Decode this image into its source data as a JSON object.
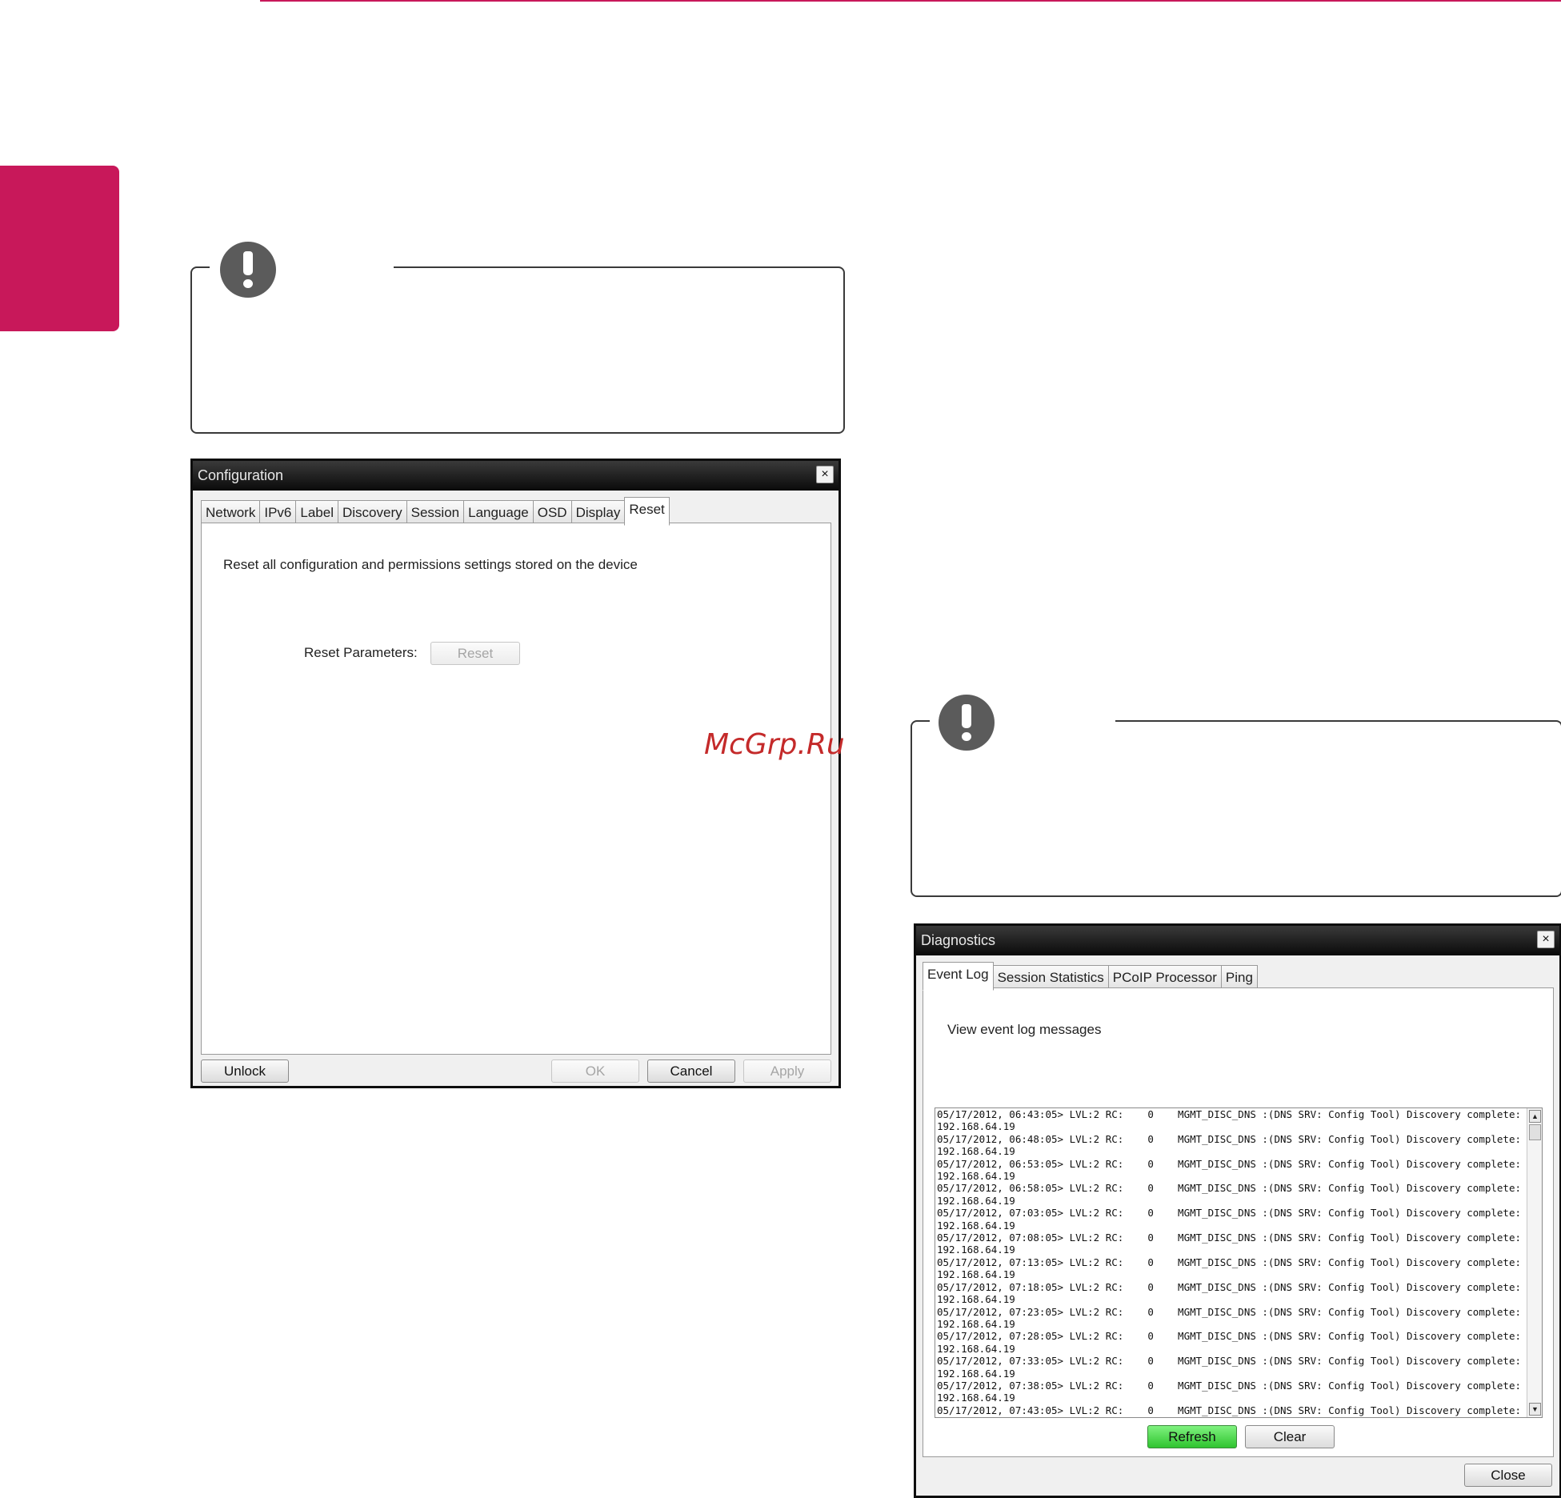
{
  "watermark": "McGrp.Ru",
  "configuration": {
    "title": "Configuration",
    "close": "×",
    "tabs": [
      "Network",
      "IPv6",
      "Label",
      "Discovery",
      "Session",
      "Language",
      "OSD",
      "Display",
      "Reset"
    ],
    "active_tab": "Reset",
    "description": "Reset all configuration and permissions settings stored on the device",
    "reset_label": "Reset Parameters:",
    "reset_button": "Reset",
    "unlock": "Unlock",
    "ok": "OK",
    "cancel": "Cancel",
    "apply": "Apply"
  },
  "diagnostics": {
    "title": "Diagnostics",
    "close": "×",
    "tabs": [
      "Event Log",
      "Session Statistics",
      "PCoIP Processor",
      "Ping"
    ],
    "active_tab": "Event Log",
    "description": "View event log messages",
    "log": [
      {
        "ts": "05/17/2012, 06:43:05>",
        "msg": "LVL:2 RC:    0    MGMT_DISC_DNS :(DNS SRV: Config Tool) Discovery complete:",
        "ip": "192.168.64.19"
      },
      {
        "ts": "05/17/2012, 06:48:05>",
        "msg": "LVL:2 RC:    0    MGMT_DISC_DNS :(DNS SRV: Config Tool) Discovery complete:",
        "ip": "192.168.64.19"
      },
      {
        "ts": "05/17/2012, 06:53:05>",
        "msg": "LVL:2 RC:    0    MGMT_DISC_DNS :(DNS SRV: Config Tool) Discovery complete:",
        "ip": "192.168.64.19"
      },
      {
        "ts": "05/17/2012, 06:58:05>",
        "msg": "LVL:2 RC:    0    MGMT_DISC_DNS :(DNS SRV: Config Tool) Discovery complete:",
        "ip": "192.168.64.19"
      },
      {
        "ts": "05/17/2012, 07:03:05>",
        "msg": "LVL:2 RC:    0    MGMT_DISC_DNS :(DNS SRV: Config Tool) Discovery complete:",
        "ip": "192.168.64.19"
      },
      {
        "ts": "05/17/2012, 07:08:05>",
        "msg": "LVL:2 RC:    0    MGMT_DISC_DNS :(DNS SRV: Config Tool) Discovery complete:",
        "ip": "192.168.64.19"
      },
      {
        "ts": "05/17/2012, 07:13:05>",
        "msg": "LVL:2 RC:    0    MGMT_DISC_DNS :(DNS SRV: Config Tool) Discovery complete:",
        "ip": "192.168.64.19"
      },
      {
        "ts": "05/17/2012, 07:18:05>",
        "msg": "LVL:2 RC:    0    MGMT_DISC_DNS :(DNS SRV: Config Tool) Discovery complete:",
        "ip": "192.168.64.19"
      },
      {
        "ts": "05/17/2012, 07:23:05>",
        "msg": "LVL:2 RC:    0    MGMT_DISC_DNS :(DNS SRV: Config Tool) Discovery complete:",
        "ip": "192.168.64.19"
      },
      {
        "ts": "05/17/2012, 07:28:05>",
        "msg": "LVL:2 RC:    0    MGMT_DISC_DNS :(DNS SRV: Config Tool) Discovery complete:",
        "ip": "192.168.64.19"
      },
      {
        "ts": "05/17/2012, 07:33:05>",
        "msg": "LVL:2 RC:    0    MGMT_DISC_DNS :(DNS SRV: Config Tool) Discovery complete:",
        "ip": "192.168.64.19"
      },
      {
        "ts": "05/17/2012, 07:38:05>",
        "msg": "LVL:2 RC:    0    MGMT_DISC_DNS :(DNS SRV: Config Tool) Discovery complete:",
        "ip": "192.168.64.19"
      },
      {
        "ts": "05/17/2012, 07:43:05>",
        "msg": "LVL:2 RC:    0    MGMT_DISC_DNS :(DNS SRV: Config Tool) Discovery complete:",
        "ip": ""
      }
    ],
    "refresh": "Refresh",
    "clear": "Clear",
    "close_button": "Close"
  }
}
